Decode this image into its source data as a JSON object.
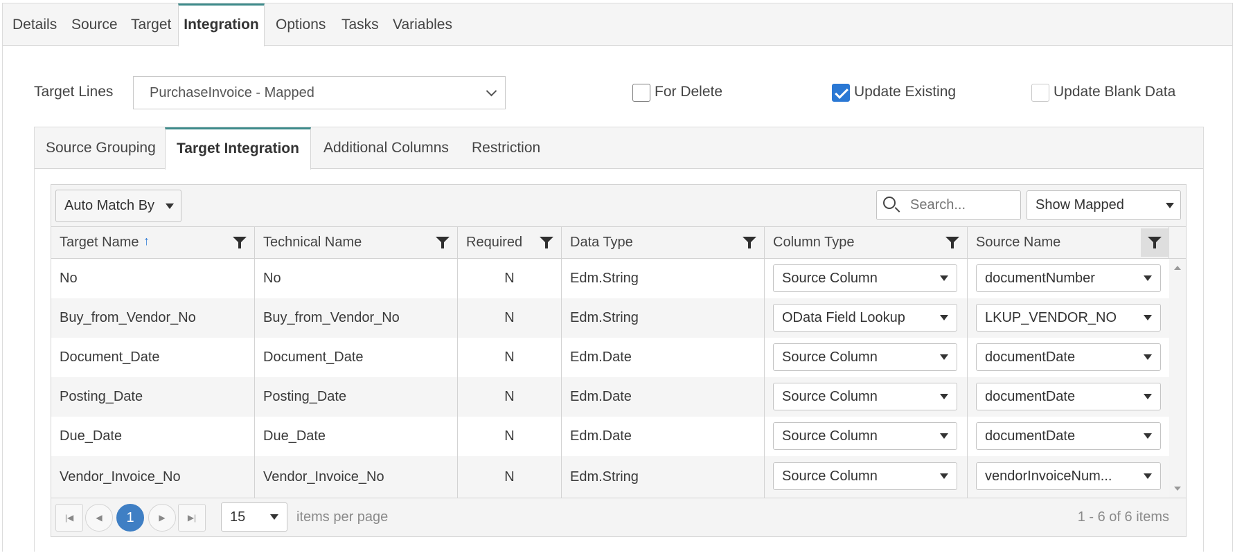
{
  "top_tabs": [
    "Details",
    "Source",
    "Target",
    "Integration",
    "Options",
    "Tasks",
    "Variables"
  ],
  "top_tab_active": "Integration",
  "target_lines": {
    "label": "Target Lines",
    "value": "PurchaseInvoice - Mapped"
  },
  "options": {
    "for_delete": {
      "label": "For Delete",
      "checked": false
    },
    "update_existing": {
      "label": "Update Existing",
      "checked": true
    },
    "update_blank": {
      "label": "Update Blank Data",
      "checked": false
    }
  },
  "sub_tabs": [
    "Source Grouping",
    "Target Integration",
    "Additional Columns",
    "Restriction"
  ],
  "sub_tab_active": "Target Integration",
  "toolbar": {
    "auto_match_label": "Auto Match By",
    "search_placeholder": "Search...",
    "show_filter_value": "Show Mapped"
  },
  "columns": [
    "Target Name",
    "Technical Name",
    "Required",
    "Data Type",
    "Column Type",
    "Source Name"
  ],
  "rows": [
    {
      "target": "No",
      "technical": "No",
      "required": "N",
      "type": "Edm.String",
      "column_type": "Source Column",
      "source": "documentNumber"
    },
    {
      "target": "Buy_from_Vendor_No",
      "technical": "Buy_from_Vendor_No",
      "required": "N",
      "type": "Edm.String",
      "column_type": "OData Field Lookup",
      "source": "LKUP_VENDOR_NO"
    },
    {
      "target": "Document_Date",
      "technical": "Document_Date",
      "required": "N",
      "type": "Edm.Date",
      "column_type": "Source Column",
      "source": "documentDate"
    },
    {
      "target": "Posting_Date",
      "technical": "Posting_Date",
      "required": "N",
      "type": "Edm.Date",
      "column_type": "Source Column",
      "source": "documentDate"
    },
    {
      "target": "Due_Date",
      "technical": "Due_Date",
      "required": "N",
      "type": "Edm.Date",
      "column_type": "Source Column",
      "source": "documentDate"
    },
    {
      "target": "Vendor_Invoice_No",
      "technical": "Vendor_Invoice_No",
      "required": "N",
      "type": "Edm.String",
      "column_type": "Source Column",
      "source": "vendorInvoiceNum..."
    }
  ],
  "pager": {
    "current_page": "1",
    "page_size": "15",
    "items_per_page_label": "items per page",
    "summary": "1 - 6 of 6 items"
  },
  "colors": {
    "accent": "#3d8a8a",
    "checkbox": "#2a78d4",
    "page_active": "#3f7fc4"
  },
  "icons": [
    "funnel-icon",
    "sort-up-icon",
    "search-icon",
    "caret-down-icon",
    "chevron-down-icon",
    "first-page-icon",
    "prev-page-icon",
    "next-page-icon",
    "last-page-icon"
  ]
}
